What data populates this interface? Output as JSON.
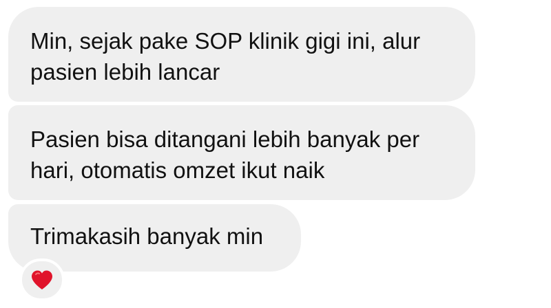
{
  "messages": [
    {
      "text": "Min, sejak pake SOP klinik gigi ini, alur\npasien lebih lancar"
    },
    {
      "text": "Pasien bisa ditangani lebih banyak per\nhari, otomatis omzet ikut naik"
    },
    {
      "text": "Trimakasih banyak min"
    }
  ],
  "reaction": {
    "icon": "heart-icon",
    "color": "#e0142b"
  }
}
